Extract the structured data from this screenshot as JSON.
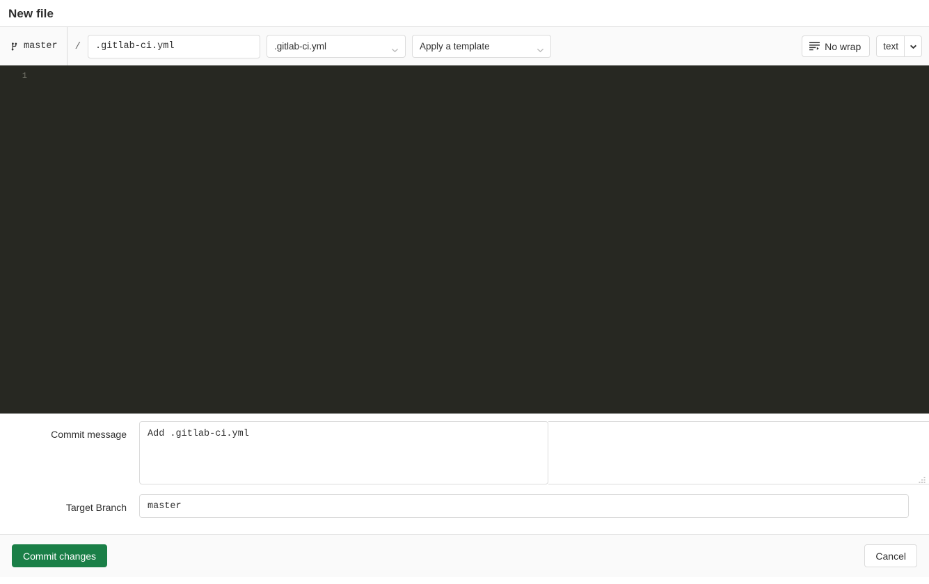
{
  "page": {
    "title": "New file"
  },
  "editor_toolbar": {
    "branch": {
      "icon": "branch-icon",
      "name": "master"
    },
    "path_separator": "/",
    "filename": {
      "value": ".gitlab-ci.yml",
      "placeholder": "File name"
    },
    "file_select": {
      "selected": ".gitlab-ci.yml",
      "options": [
        ".gitlab-ci.yml"
      ],
      "icon": "chevron-down-icon"
    },
    "template_select": {
      "selected": "Apply a template",
      "options": [
        "Apply a template"
      ],
      "icon": "chevron-down-icon"
    },
    "wrap_button": {
      "label": "No wrap",
      "icon": "no-wrap-icon"
    },
    "mode_button": {
      "label": "text",
      "icon": "chevron-down-icon"
    }
  },
  "code_editor": {
    "line_numbers": [
      "1"
    ],
    "lines": [
      ""
    ],
    "background_color": "#272822",
    "gutter_color": "#6f7066"
  },
  "commit_form": {
    "message_label": "Commit message",
    "message_value": "Add .gitlab-ci.yml",
    "message_placeholder": "Add .gitlab-ci.yml",
    "branch_label": "Target Branch",
    "branch_value": "master",
    "branch_placeholder": "master"
  },
  "actions": {
    "commit_label": "Commit changes",
    "commit_color": "#1a7f47",
    "cancel_label": "Cancel"
  }
}
